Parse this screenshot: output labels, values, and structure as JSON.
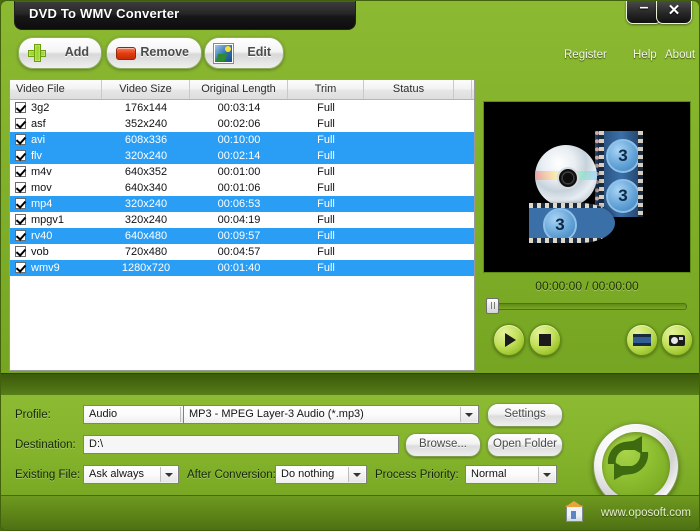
{
  "window": {
    "title": "DVD To WMV Converter",
    "minimize_label": "–",
    "close_label": "✕"
  },
  "toolbar": {
    "add_label": "Add",
    "remove_label": "Remove",
    "edit_label": "Edit"
  },
  "menu": {
    "register": "Register",
    "help": "Help",
    "about": "About"
  },
  "file_list": {
    "columns": [
      "Video File",
      "Video Size",
      "Original Length",
      "Trim",
      "Status"
    ],
    "rows": [
      {
        "checked": true,
        "name": "3g2",
        "size": "176x144",
        "length": "00:03:14",
        "trim": "Full",
        "status": "",
        "selected": false
      },
      {
        "checked": true,
        "name": "asf",
        "size": "352x240",
        "length": "00:02:06",
        "trim": "Full",
        "status": "",
        "selected": false
      },
      {
        "checked": true,
        "name": "avi",
        "size": "608x336",
        "length": "00:10:00",
        "trim": "Full",
        "status": "",
        "selected": true
      },
      {
        "checked": true,
        "name": "flv",
        "size": "320x240",
        "length": "00:02:14",
        "trim": "Full",
        "status": "",
        "selected": true
      },
      {
        "checked": true,
        "name": "m4v",
        "size": "640x352",
        "length": "00:01:00",
        "trim": "Full",
        "status": "",
        "selected": false
      },
      {
        "checked": true,
        "name": "mov",
        "size": "640x340",
        "length": "00:01:06",
        "trim": "Full",
        "status": "",
        "selected": false
      },
      {
        "checked": true,
        "name": "mp4",
        "size": "320x240",
        "length": "00:06:53",
        "trim": "Full",
        "status": "",
        "selected": true
      },
      {
        "checked": true,
        "name": "mpgv1",
        "size": "320x240",
        "length": "00:04:19",
        "trim": "Full",
        "status": "",
        "selected": false
      },
      {
        "checked": true,
        "name": "rv40",
        "size": "640x480",
        "length": "00:09:57",
        "trim": "Full",
        "status": "",
        "selected": true
      },
      {
        "checked": true,
        "name": "vob",
        "size": "720x480",
        "length": "00:04:57",
        "trim": "Full",
        "status": "",
        "selected": false
      },
      {
        "checked": true,
        "name": "wmv9",
        "size": "1280x720",
        "length": "00:01:40",
        "trim": "Full",
        "status": "",
        "selected": true
      }
    ]
  },
  "preview": {
    "time_display": "00:00:00 / 00:00:00",
    "frame_number": "3",
    "play_label": "play-icon",
    "stop_label": "stop-icon",
    "snapshot_series_label": "film-snapshot-icon",
    "snapshot_label": "camera-snapshot-icon"
  },
  "settings": {
    "profile_label": "Profile:",
    "profile_category": "Audio",
    "profile_format": "MP3 - MPEG Layer-3 Audio (*.mp3)",
    "settings_button": "Settings",
    "destination_label": "Destination:",
    "destination_value": "D:\\",
    "browse_button": "Browse...",
    "open_folder_button": "Open Folder",
    "existing_file_label": "Existing File:",
    "existing_file_value": "Ask always",
    "after_conversion_label": "After Conversion:",
    "after_conversion_value": "Do nothing",
    "process_priority_label": "Process Priority:",
    "process_priority_value": "Normal"
  },
  "footer": {
    "website": "www.oposoft.com"
  },
  "colors": {
    "brand_green": "#8cbb33",
    "dark_green": "#4a6c11",
    "selection_blue": "#2a9df4",
    "title_black": "#171717"
  }
}
